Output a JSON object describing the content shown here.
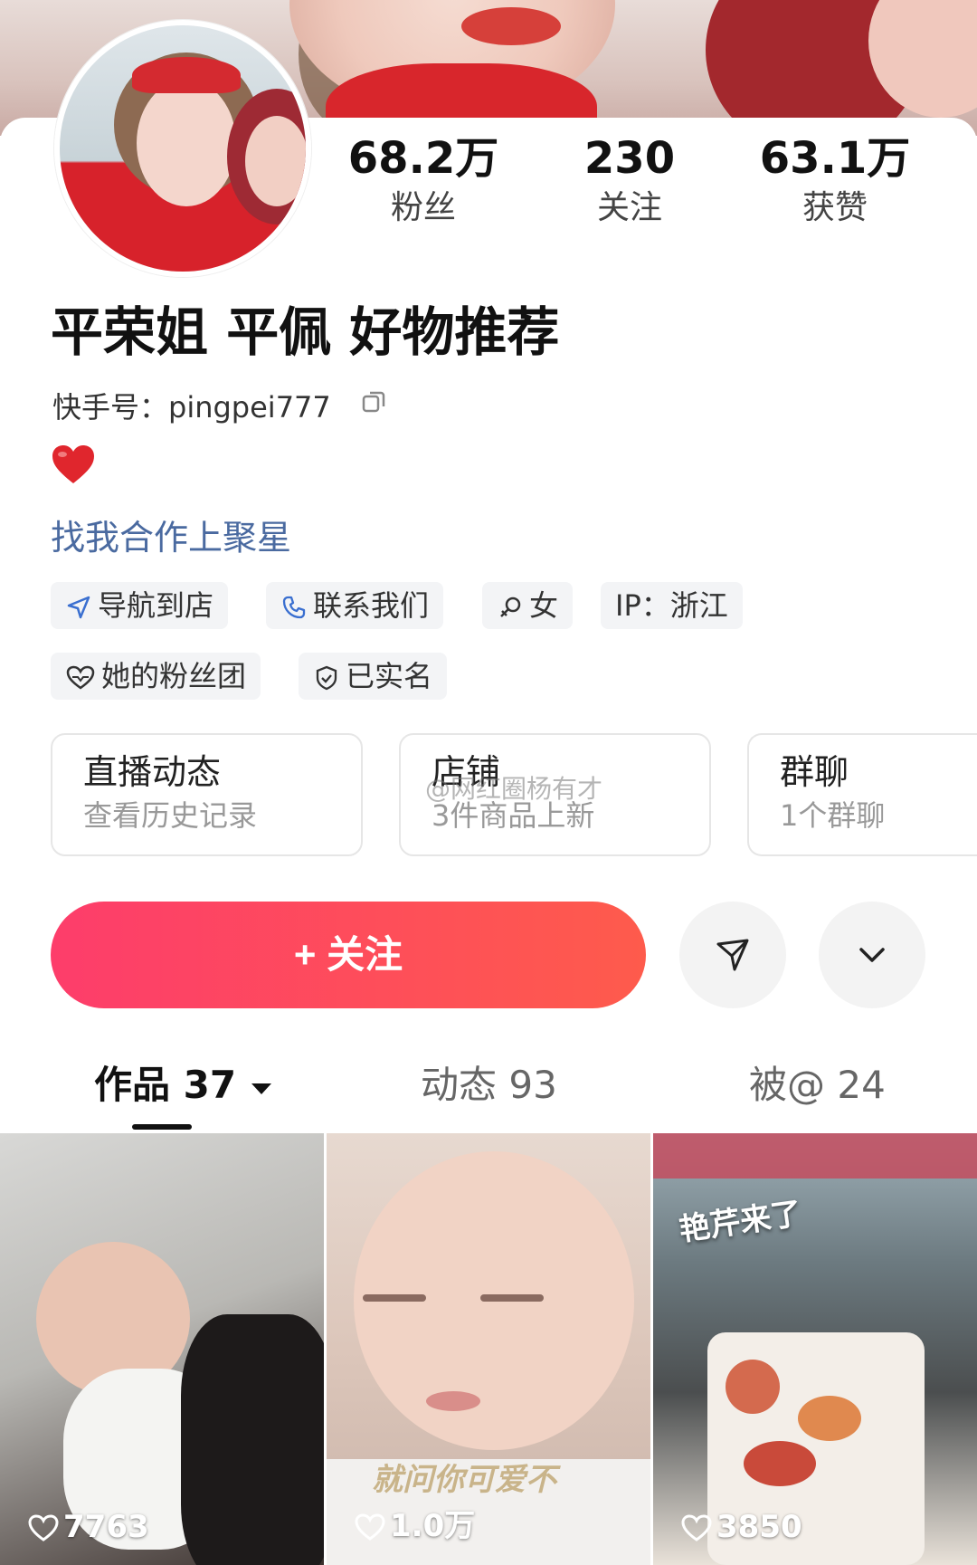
{
  "profile": {
    "name": "平荣姐 平佩 好物推荐",
    "kuaishou_id": "快手号：pingpei777",
    "bio_link": "找我合作上聚星"
  },
  "stats": [
    {
      "value": "68.2万",
      "label": "粉丝"
    },
    {
      "value": "230",
      "label": "关注"
    },
    {
      "value": "63.1万",
      "label": "获赞"
    }
  ],
  "tags": {
    "navigate": "导航到店",
    "contact": "联系我们",
    "gender": "女",
    "ip": "IP：浙江",
    "fan_group": "她的粉丝团",
    "verified": "已实名"
  },
  "cards": [
    {
      "title": "直播动态",
      "subtitle": "查看历史记录"
    },
    {
      "title": "店铺",
      "subtitle": "3件商品上新"
    },
    {
      "title": "群聊",
      "subtitle": "1个群聊"
    }
  ],
  "follow_button": "+ 关注",
  "tabs": [
    {
      "label": "作品 37",
      "active": true
    },
    {
      "label": "动态 93",
      "active": false
    },
    {
      "label": "被@ 24",
      "active": false
    }
  ],
  "videos": [
    {
      "likes": "7763",
      "caption": ""
    },
    {
      "likes": "1.0万",
      "caption": "就问你可爱不"
    },
    {
      "likes": "3850",
      "caption": "艳芹来了"
    }
  ],
  "watermark": "@网红圈杨有才",
  "colors": {
    "accent": "#fe4a5e",
    "link": "#4a6aa0",
    "heart": "#e0262d"
  },
  "icons": [
    "copy-icon",
    "heart-emoji-icon",
    "navigate-icon",
    "phone-icon",
    "female-icon",
    "fan-heart-icon",
    "shield-check-icon",
    "share-icon",
    "chevron-down-icon",
    "dropdown-triangle-icon",
    "like-heart-icon"
  ]
}
